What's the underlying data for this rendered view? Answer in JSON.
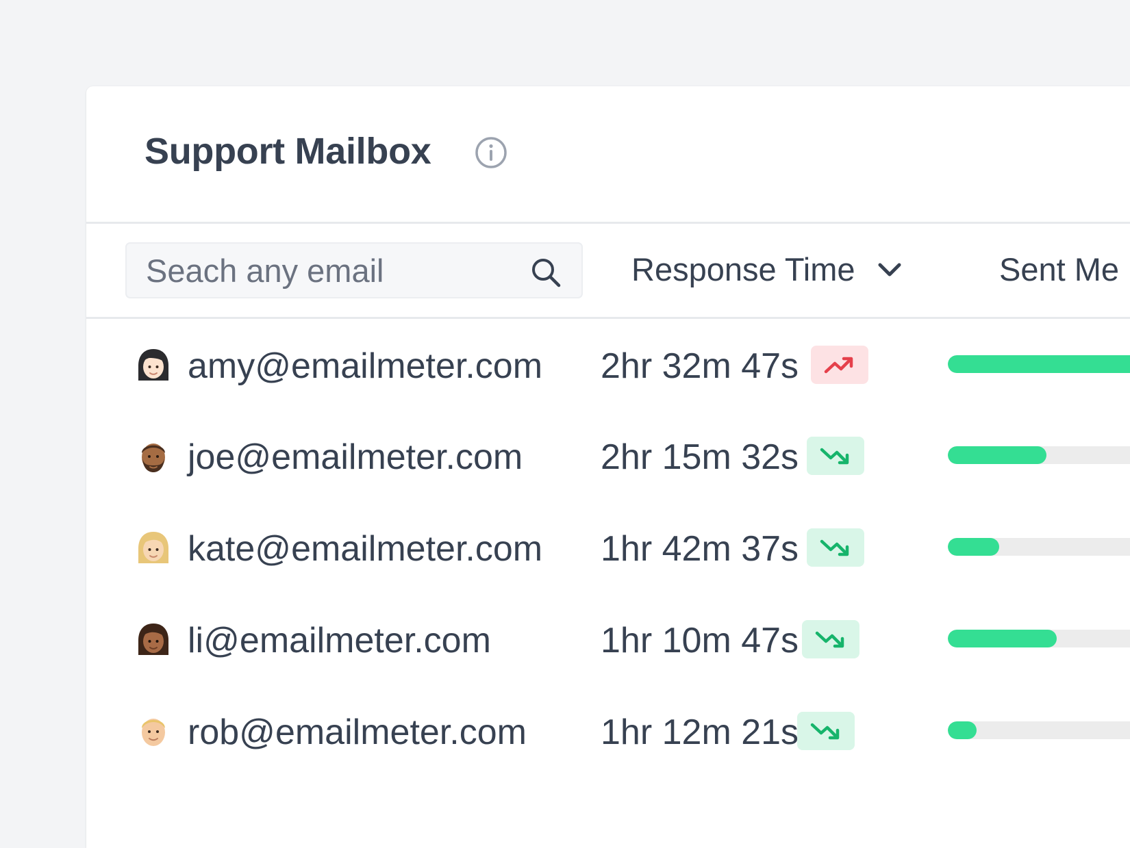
{
  "header": {
    "title": "Support Mailbox",
    "info_icon": "info-circle-icon"
  },
  "search": {
    "placeholder": "Seach any email",
    "value": "",
    "icon": "search-icon"
  },
  "columns": {
    "response_time": "Response Time",
    "response_time_sort_icon": "chevron-down-icon",
    "sent_messages": "Sent Me"
  },
  "colors": {
    "bar_fill": "#34de93",
    "bar_track": "#ececec",
    "trend_up_bg": "#fde2e4",
    "trend_up_fg": "#e5404b",
    "trend_down_bg": "#d9f6e8",
    "trend_down_fg": "#16b46b"
  },
  "rows": [
    {
      "avatar": "woman-dark-hair-avatar",
      "email": "amy@emailmeter.com",
      "response_time": "2hr 32m 47s",
      "trend": "up",
      "trend_icon": "trending-up-icon",
      "sent_fraction": 1.0
    },
    {
      "avatar": "man-bearded-avatar",
      "email": "joe@emailmeter.com",
      "response_time": "2hr 15m 32s",
      "trend": "down",
      "trend_icon": "trending-down-icon",
      "sent_fraction": 0.48
    },
    {
      "avatar": "woman-blonde-avatar",
      "email": "kate@emailmeter.com",
      "response_time": "1hr 42m 37s",
      "trend": "down",
      "trend_icon": "trending-down-icon",
      "sent_fraction": 0.25
    },
    {
      "avatar": "woman-brown-avatar",
      "email": "li@emailmeter.com",
      "response_time": "1hr 10m 47s",
      "trend": "down",
      "trend_icon": "trending-down-icon",
      "sent_fraction": 0.53
    },
    {
      "avatar": "man-blond-avatar",
      "email": "rob@emailmeter.com",
      "response_time": "1hr 12m 21s",
      "trend": "down",
      "trend_icon": "trending-down-icon",
      "sent_fraction": 0.14
    }
  ]
}
